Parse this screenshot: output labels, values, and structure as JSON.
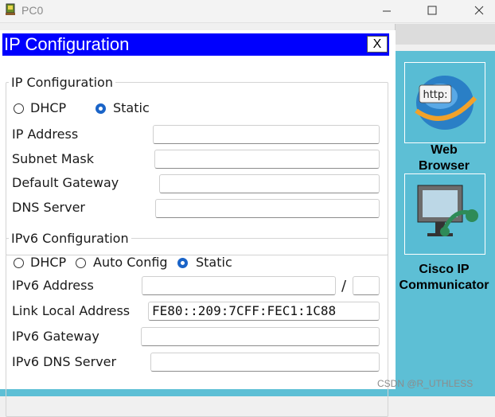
{
  "window": {
    "title": "PC0",
    "minimize_icon": "minimize-icon",
    "maximize_icon": "maximize-icon",
    "close_icon": "close-icon"
  },
  "dialog": {
    "title": "IP Configuration",
    "close_label": "X",
    "header_color": "#0000fe"
  },
  "ipv4": {
    "legend": "IP Configuration",
    "dhcp_label": "DHCP",
    "static_label": "Static",
    "selected_mode": "Static",
    "ip_address_label": "IP Address",
    "ip_address_value": "",
    "subnet_mask_label": "Subnet Mask",
    "subnet_mask_value": "",
    "default_gateway_label": "Default Gateway",
    "default_gateway_value": "",
    "dns_server_label": "DNS Server",
    "dns_server_value": ""
  },
  "ipv6": {
    "legend": "IPv6 Configuration",
    "dhcp_label": "DHCP",
    "auto_config_label": "Auto Config",
    "static_label": "Static",
    "selected_mode": "Static",
    "address_label": "IPv6 Address",
    "address_value": "",
    "prefix_separator": "/",
    "prefix_value": "",
    "link_local_label": "Link Local Address",
    "link_local_value": "FE80::209:7CFF:FEC1:1C88",
    "gateway_label": "IPv6 Gateway",
    "gateway_value": "",
    "dns_server_label": "IPv6 DNS Server",
    "dns_server_value": ""
  },
  "desktop_apps": [
    {
      "label": "Web\nBrowser",
      "icon": "web-browser-icon"
    },
    {
      "label": "Cisco IP\nCommunicator",
      "icon": "cisco-ip-communicator-icon"
    }
  ],
  "colors": {
    "desktop_bg": "#5dbfd5",
    "radio_selected": "#1a64c8"
  },
  "watermark": "CSDN @R_UTHLESS"
}
